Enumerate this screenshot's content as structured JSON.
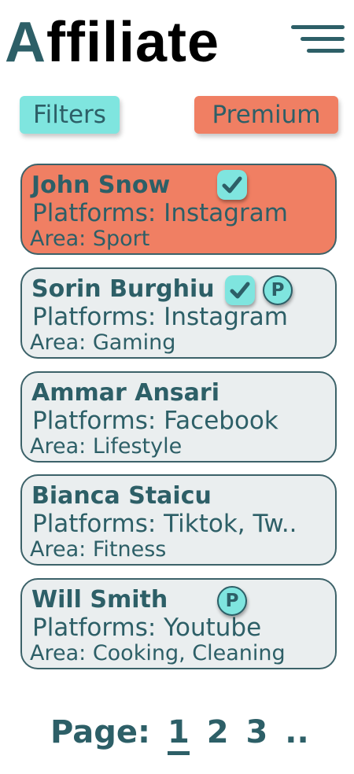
{
  "header": {
    "logo_first_letter": "A",
    "logo_rest": "ffiliate",
    "menu_icon": "hamburger-menu-icon"
  },
  "toolbar": {
    "filters_label": "Filters",
    "premium_label": "Premium"
  },
  "colors": {
    "primary": "#2d5f67",
    "accent_teal": "#7fe5df",
    "accent_coral": "#f07f63",
    "card_background": "#eaeeef"
  },
  "affiliates": [
    {
      "name": "John Snow",
      "platforms": "Platforms: Instagram",
      "area": "Area: Sport",
      "verified": true,
      "premium": false,
      "highlighted": true
    },
    {
      "name": "Sorin Burghiu",
      "platforms": "Platforms: Instagram",
      "area": "Area: Gaming",
      "verified": true,
      "premium": true,
      "premium_badge": "P",
      "highlighted": false
    },
    {
      "name": "Ammar Ansari",
      "platforms": "Platforms: Facebook",
      "area": "Area: Lifestyle",
      "verified": false,
      "premium": false,
      "highlighted": false
    },
    {
      "name": "Bianca Staicu",
      "platforms": "Platforms: Tiktok, Tw..",
      "area": "Area: Fitness",
      "verified": false,
      "premium": false,
      "highlighted": false
    },
    {
      "name": "Will Smith",
      "platforms": "Platforms: Youtube",
      "area": "Area: Cooking, Cleaning",
      "verified": false,
      "premium": true,
      "premium_badge": "P",
      "highlighted": false
    }
  ],
  "pagination": {
    "label": "Page:",
    "pages": [
      "1",
      "2",
      "3"
    ],
    "current": "1",
    "more": ".."
  }
}
